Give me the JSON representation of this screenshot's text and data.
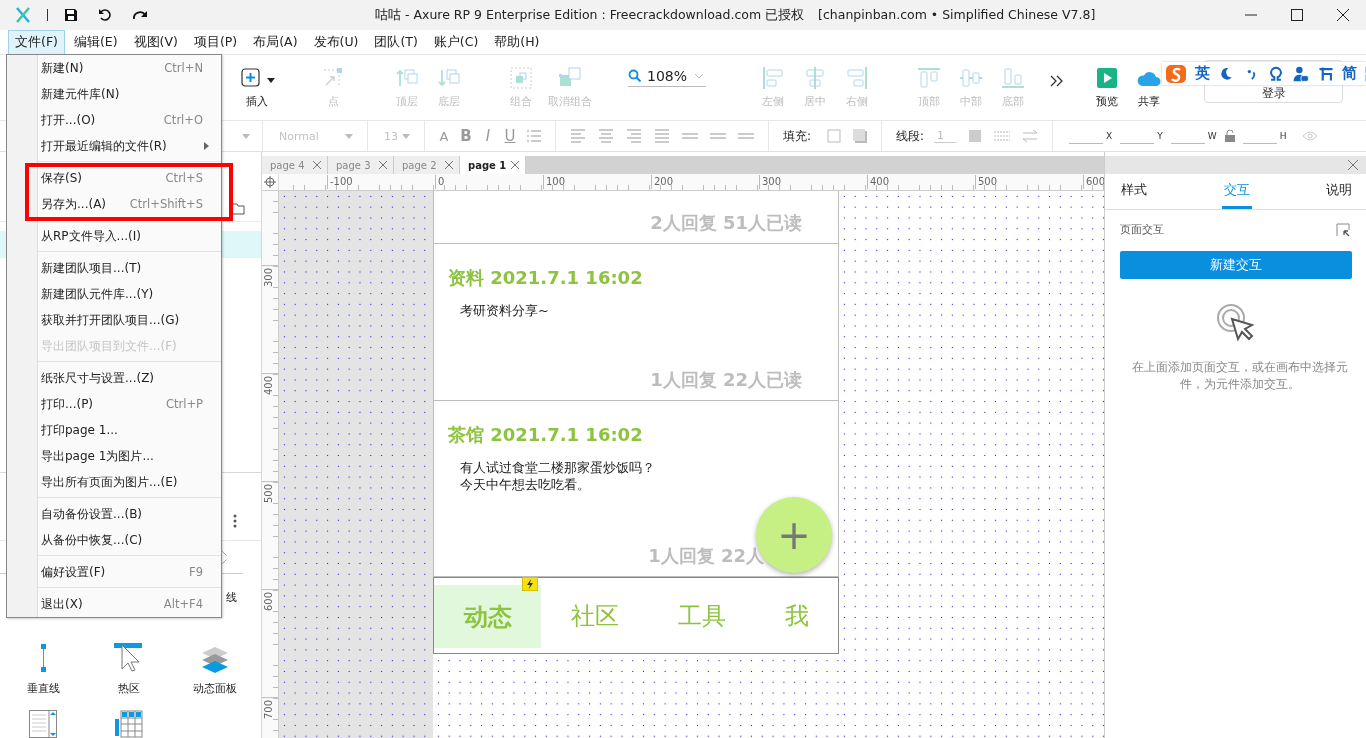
{
  "title_bar": {
    "title": "咕咕 - Axure RP 9 Enterprise Edition : Freecrackdownload.com 已授权",
    "subtitle": "[chanpinban.com • Simplified Chinese V7.8]"
  },
  "menu_bar": [
    {
      "label": "文件(F)",
      "selected": true
    },
    {
      "label": "编辑(E)",
      "selected": false
    },
    {
      "label": "视图(V)",
      "selected": false
    },
    {
      "label": "项目(P)",
      "selected": false
    },
    {
      "label": "布局(A)",
      "selected": false
    },
    {
      "label": "发布(U)",
      "selected": false
    },
    {
      "label": "团队(T)",
      "selected": false
    },
    {
      "label": "账户(C)",
      "selected": false
    },
    {
      "label": "帮助(H)",
      "selected": false
    }
  ],
  "file_menu": {
    "groups": [
      {
        "highlighted": false,
        "items": [
          {
            "label": "新建(N)",
            "shortcut": "Ctrl+N",
            "disabled": false,
            "submenu": false
          },
          {
            "label": "新建元件库(N)",
            "disabled": false,
            "submenu": false
          },
          {
            "label": "打开...(O)",
            "shortcut": "Ctrl+O",
            "disabled": false,
            "submenu": false
          },
          {
            "label": "打开最近编辑的文件(R)",
            "disabled": false,
            "submenu": true
          }
        ]
      },
      {
        "highlighted": true,
        "items": [
          {
            "label": "保存(S)",
            "shortcut": "Ctrl+S",
            "disabled": false,
            "submenu": false
          },
          {
            "label": "另存为...(A)",
            "shortcut": "Ctrl+Shift+S",
            "disabled": false,
            "submenu": false
          }
        ]
      },
      {
        "highlighted": false,
        "items": [
          {
            "label": "从RP文件导入...(I)",
            "disabled": false,
            "submenu": false
          }
        ]
      },
      {
        "highlighted": false,
        "items": [
          {
            "label": "新建团队项目...(T)",
            "disabled": false,
            "submenu": false
          },
          {
            "label": "新建团队元件库...(Y)",
            "disabled": false,
            "submenu": false
          },
          {
            "label": "获取并打开团队项目...(G)",
            "disabled": false,
            "submenu": false
          },
          {
            "label": "导出团队项目到文件...(F)",
            "disabled": true,
            "submenu": false
          }
        ]
      },
      {
        "highlighted": false,
        "items": [
          {
            "label": "纸张尺寸与设置...(Z)",
            "disabled": false,
            "submenu": false
          },
          {
            "label": "打印...(P)",
            "shortcut": "Ctrl+P",
            "disabled": false,
            "submenu": false
          },
          {
            "label": "打印page 1...",
            "disabled": false,
            "submenu": false
          },
          {
            "label": "导出page 1为图片...",
            "disabled": false,
            "submenu": false
          },
          {
            "label": "导出所有页面为图片...(E)",
            "disabled": false,
            "submenu": false
          }
        ]
      },
      {
        "highlighted": false,
        "items": [
          {
            "label": "自动备份设置...(B)",
            "disabled": false,
            "submenu": false
          },
          {
            "label": "从备份中恢复...(C)",
            "disabled": false,
            "submenu": false
          }
        ]
      },
      {
        "highlighted": false,
        "items": [
          {
            "label": "偏好设置(F)",
            "shortcut": "F9",
            "disabled": false,
            "submenu": false
          }
        ]
      },
      {
        "highlighted": false,
        "items": [
          {
            "label": "退出(X)",
            "shortcut": "Alt+F4",
            "disabled": false,
            "submenu": false
          }
        ]
      }
    ]
  },
  "toolbar": {
    "arrange": [
      {
        "kind": "insert",
        "label": "插入",
        "disabled": false
      },
      {
        "kind": "point",
        "label": "点",
        "disabled": true
      },
      {
        "kind": "front",
        "label": "顶层",
        "disabled": true
      },
      {
        "kind": "back",
        "label": "底层",
        "disabled": true
      },
      {
        "kind": "group",
        "label": "组合",
        "disabled": true
      },
      {
        "kind": "ungroup",
        "label": "取消组合",
        "disabled": true
      }
    ],
    "zoom": "108%",
    "align": [
      {
        "kind": "left",
        "label": "左侧",
        "disabled": true
      },
      {
        "kind": "center",
        "label": "居中",
        "disabled": true
      },
      {
        "kind": "right",
        "label": "右侧",
        "disabled": true
      },
      {
        "kind": "top",
        "label": "顶部",
        "disabled": true
      },
      {
        "kind": "middle",
        "label": "中部",
        "disabled": true
      },
      {
        "kind": "bottom",
        "label": "底部",
        "disabled": true
      }
    ],
    "actions": [
      {
        "kind": "preview",
        "label": "预览",
        "disabled": false
      },
      {
        "kind": "share",
        "label": "共享",
        "disabled": false
      }
    ],
    "login": "登录"
  },
  "ime_bar": [
    {
      "kind": "logo"
    },
    {
      "kind": "text",
      "label": "英"
    },
    {
      "kind": "moon"
    },
    {
      "kind": "punct"
    },
    {
      "kind": "omega"
    },
    {
      "kind": "person"
    },
    {
      "kind": "tool"
    },
    {
      "kind": "text",
      "label": "简"
    },
    {
      "kind": "grid"
    }
  ],
  "format_bar": {
    "font_style": "Normal",
    "font_field": "13",
    "text_buttons": [
      "A",
      "B",
      "I",
      "U"
    ],
    "fill_label": "填充:",
    "stroke_label": "线段:",
    "stroke_field": "1",
    "position_fields": [
      "X",
      "Y",
      "W",
      "H"
    ]
  },
  "left_panel": {
    "widgets": [
      {
        "kind": "hidden",
        "label": "线"
      },
      {
        "kind": "vline",
        "label": "垂直线"
      },
      {
        "kind": "hotspot",
        "label": "热区"
      },
      {
        "kind": "panel",
        "label": "动态面板"
      },
      {
        "kind": "repeater"
      },
      {
        "kind": "table"
      }
    ]
  },
  "page_tabs": [
    {
      "label": "page 4",
      "selected": false
    },
    {
      "label": "page 3",
      "selected": false
    },
    {
      "label": "page 2",
      "selected": false
    },
    {
      "label": "page 1",
      "selected": true
    }
  ],
  "rulers": {
    "horizontal": [
      "-100",
      "0",
      "100",
      "200",
      "300",
      "400",
      "500",
      "600"
    ],
    "vertical": [
      "300",
      "400",
      "500",
      "600",
      "700"
    ]
  },
  "canvas": {
    "cards": [
      {
        "stats": "2人回复 51人已读"
      },
      {
        "title": "资料 2021.7.1 16:02",
        "body": [
          "考研资料分享~"
        ],
        "stats": "1人回复 22人已读"
      },
      {
        "title": "茶馆 2021.7.1 16:02",
        "body": [
          "有人试过食堂二楼那家蛋炒饭吗？",
          "今天中午想去吃吃看。"
        ],
        "stats": "1人回复 22人"
      }
    ],
    "fab": "+",
    "bottom_nav": [
      {
        "label": "动态",
        "selected": true
      },
      {
        "label": "社区",
        "selected": false
      },
      {
        "label": "工具",
        "selected": false
      },
      {
        "label": "我",
        "selected": false
      }
    ]
  },
  "right_panel": {
    "tabs": [
      {
        "label": "样式",
        "selected": false
      },
      {
        "label": "交互",
        "selected": true
      },
      {
        "label": "说明",
        "selected": false
      }
    ],
    "section_label": "页面交互",
    "button": "新建交互",
    "hint": "在上面添加页面交互，或在画布中选择元件，为元件添加交互。"
  }
}
